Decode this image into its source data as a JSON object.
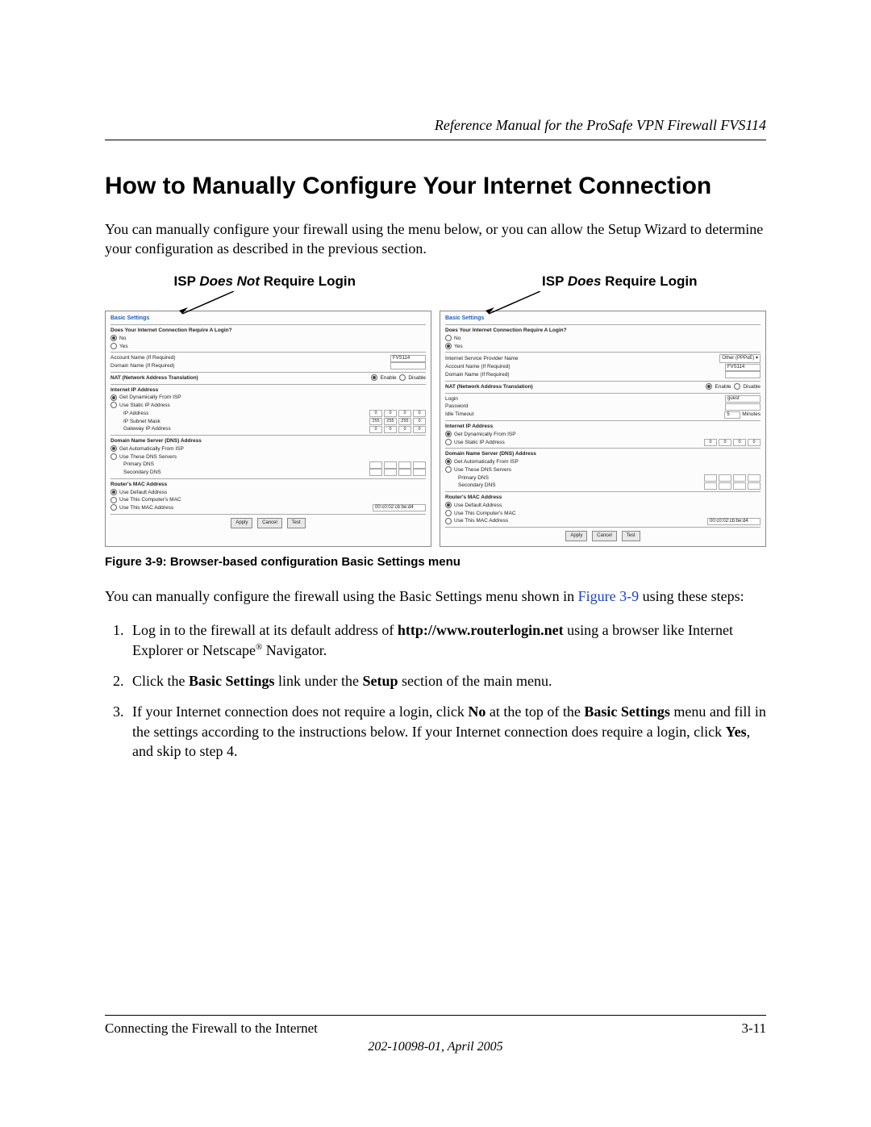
{
  "header": {
    "manual_title": "Reference Manual for the ProSafe VPN Firewall FVS114"
  },
  "section": {
    "heading": "How to Manually Configure Your Internet Connection"
  },
  "intro": "You can manually configure your firewall using the menu below, or you can allow the Setup Wizard to determine your configuration as described in the previous section.",
  "figure": {
    "left_label_pre": "ISP ",
    "left_label_em": "Does Not",
    "left_label_post": " Require Login",
    "right_label_pre": "ISP ",
    "right_label_em": "Does",
    "right_label_post": " Require Login",
    "panel_title": "Basic Settings",
    "login_q": "Does Your Internet Connection Require A Login?",
    "opt_no": "No",
    "opt_yes": "Yes",
    "account_name": "Account Name  (If Required)",
    "domain_name": "Domain Name  (If Required)",
    "isp_name": "Internet Service Provider Name",
    "isp_type_value": "Other (PPPoE)",
    "login_lbl": "Login",
    "login_value": "guest",
    "password_lbl": "Password",
    "idle_lbl": "Idle Timeout",
    "idle_value": "5",
    "idle_unit": "Minutes",
    "fvs_value": "FVS114",
    "nat_heading": "NAT (Network Address Translation)",
    "nat_enable": "Enable",
    "nat_disable": "Disable",
    "ip_heading": "Internet IP Address",
    "ip_dyn": "Get Dynamically From ISP",
    "ip_static": "Use Static IP Address",
    "ip_addr": "IP Address",
    "ip_mask": "IP Subnet Mask",
    "ip_gw": "Gateway IP Address",
    "dns_heading": "Domain Name Server (DNS) Address",
    "dns_auto": "Get Automatically From ISP",
    "dns_these": "Use These DNS Servers",
    "dns_primary": "Primary DNS",
    "dns_secondary": "Secondary DNS",
    "mac_heading": "Router's MAC Address",
    "mac_default": "Use Default Address",
    "mac_pc": "Use This Computer's MAC",
    "mac_this": "Use This MAC Address",
    "mac_value": "00:c0:02:cb:be:d4",
    "btn_apply": "Apply",
    "btn_cancel": "Cancel",
    "btn_test": "Test",
    "oct0": "0",
    "oct255": "255",
    "caption": "Figure 3-9:  Browser-based configuration Basic Settings menu"
  },
  "body2_pre": "You can manually configure the firewall using the Basic Settings menu shown in ",
  "body2_link": "Figure 3-9",
  "body2_post": " using these steps:",
  "steps": {
    "s1a": "Log in to the firewall at its default address of ",
    "s1b": "http://www.routerlogin.net",
    "s1c": " using a browser like Internet Explorer or Netscape",
    "s1d": " Navigator.",
    "s2a": "Click the ",
    "s2b": "Basic Settings",
    "s2c": " link under the ",
    "s2d": "Setup",
    "s2e": " section of the main menu.",
    "s3a": "If your Internet connection does not require a login, click ",
    "s3b": "No",
    "s3c": " at the top of the ",
    "s3d": "Basic Settings",
    "s3e": " menu and fill in the settings according to the instructions below. If your Internet connection does require a login, click ",
    "s3f": "Yes",
    "s3g": ", and skip to step 4."
  },
  "footer": {
    "chapter": "Connecting the Firewall to the Internet",
    "page_num": "3-11",
    "doc_id": "202-10098-01, April 2005"
  }
}
